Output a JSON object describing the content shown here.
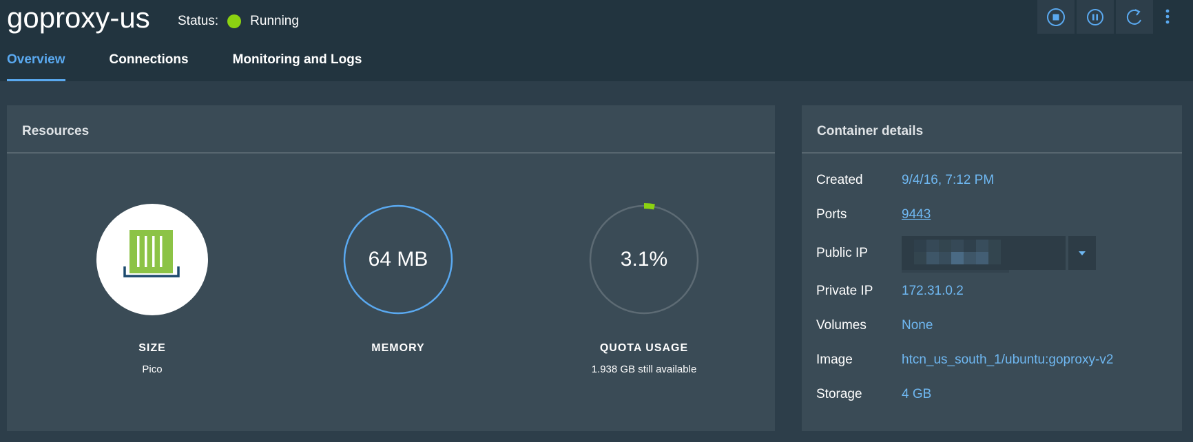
{
  "header": {
    "title": "goproxy-us",
    "status_label": "Status:",
    "status_value": "Running",
    "status_color": "#8cd211"
  },
  "tabs": [
    {
      "label": "Overview",
      "active": true
    },
    {
      "label": "Connections",
      "active": false
    },
    {
      "label": "Monitoring and Logs",
      "active": false
    }
  ],
  "actions": [
    {
      "icon": "stop-icon",
      "label": "Stop"
    },
    {
      "icon": "pause-icon",
      "label": "Pause"
    },
    {
      "icon": "restart-icon",
      "label": "Restart"
    },
    {
      "icon": "more-vertical-icon",
      "label": "More"
    }
  ],
  "resources": {
    "title": "Resources",
    "size": {
      "label": "SIZE",
      "value": "Pico",
      "icon": "container-icon"
    },
    "memory": {
      "label": "MEMORY",
      "value": "64 MB"
    },
    "quota": {
      "label": "QUOTA USAGE",
      "value": "3.1%",
      "percent": 3.1,
      "sub": "1.938 GB still available"
    }
  },
  "details": {
    "title": "Container details",
    "created": {
      "label": "Created",
      "value": "9/4/16, 7:12 PM"
    },
    "ports": {
      "label": "Ports",
      "value": "9443"
    },
    "public_ip": {
      "label": "Public IP",
      "value": ""
    },
    "private_ip": {
      "label": "Private IP",
      "value": "172.31.0.2"
    },
    "volumes": {
      "label": "Volumes",
      "value": "None"
    },
    "image": {
      "label": "Image",
      "value": "htcn_us_south_1/ubuntu:goproxy-v2"
    },
    "storage": {
      "label": "Storage",
      "value": "4 GB"
    }
  },
  "colors": {
    "accent": "#5aa9f0",
    "link": "#6fb8f2",
    "running": "#8cd211",
    "header_bg": "#22343f",
    "panel_bg": "#3a4b56"
  }
}
